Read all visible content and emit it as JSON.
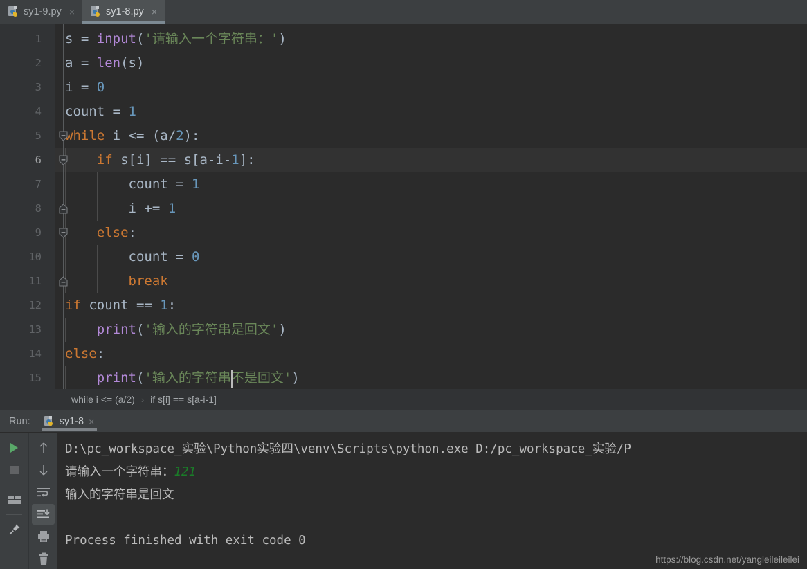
{
  "editor_tabs": [
    {
      "label": "sy1-9.py",
      "icon": "python-file-icon",
      "close": "×",
      "active": false
    },
    {
      "label": "sy1-8.py",
      "icon": "python-file-icon",
      "close": "×",
      "active": true
    }
  ],
  "code": {
    "lines": [
      {
        "n": "1",
        "tokens": [
          {
            "t": "s",
            "c": "var"
          },
          {
            "t": " = ",
            "c": "op"
          },
          {
            "t": "input",
            "c": "fn"
          },
          {
            "t": "(",
            "c": "op"
          },
          {
            "t": "'请输入一个字符串：'",
            "c": "str"
          },
          {
            "t": ")",
            "c": "op"
          }
        ]
      },
      {
        "n": "2",
        "tokens": [
          {
            "t": "a",
            "c": "var"
          },
          {
            "t": " = ",
            "c": "op"
          },
          {
            "t": "len",
            "c": "fn"
          },
          {
            "t": "(s)",
            "c": "op"
          }
        ]
      },
      {
        "n": "3",
        "tokens": [
          {
            "t": "i",
            "c": "var"
          },
          {
            "t": " = ",
            "c": "op"
          },
          {
            "t": "0",
            "c": "num"
          }
        ]
      },
      {
        "n": "4",
        "tokens": [
          {
            "t": "count",
            "c": "var"
          },
          {
            "t": " = ",
            "c": "op"
          },
          {
            "t": "1",
            "c": "num"
          }
        ]
      },
      {
        "n": "5",
        "tokens": [
          {
            "t": "while",
            "c": "kw"
          },
          {
            "t": " i <= (a/",
            "c": "op"
          },
          {
            "t": "2",
            "c": "num"
          },
          {
            "t": "):",
            "c": "op"
          }
        ]
      },
      {
        "n": "6",
        "tokens": [
          {
            "t": "    ",
            "c": "op"
          },
          {
            "t": "if",
            "c": "kw"
          },
          {
            "t": " s[i] == s[a-i-",
            "c": "op"
          },
          {
            "t": "1",
            "c": "num"
          },
          {
            "t": "]:",
            "c": "op"
          }
        ]
      },
      {
        "n": "7",
        "tokens": [
          {
            "t": "        count = ",
            "c": "op"
          },
          {
            "t": "1",
            "c": "num"
          }
        ]
      },
      {
        "n": "8",
        "tokens": [
          {
            "t": "        i += ",
            "c": "op"
          },
          {
            "t": "1",
            "c": "num"
          }
        ]
      },
      {
        "n": "9",
        "tokens": [
          {
            "t": "    ",
            "c": "op"
          },
          {
            "t": "else",
            "c": "kw"
          },
          {
            "t": ":",
            "c": "op"
          }
        ]
      },
      {
        "n": "10",
        "tokens": [
          {
            "t": "        count = ",
            "c": "op"
          },
          {
            "t": "0",
            "c": "num"
          }
        ]
      },
      {
        "n": "11",
        "tokens": [
          {
            "t": "        ",
            "c": "op"
          },
          {
            "t": "break",
            "c": "kw"
          }
        ]
      },
      {
        "n": "12",
        "tokens": [
          {
            "t": "if",
            "c": "kw"
          },
          {
            "t": " count == ",
            "c": "op"
          },
          {
            "t": "1",
            "c": "num"
          },
          {
            "t": ":",
            "c": "op"
          }
        ]
      },
      {
        "n": "13",
        "tokens": [
          {
            "t": "    ",
            "c": "op"
          },
          {
            "t": "print",
            "c": "fn"
          },
          {
            "t": "(",
            "c": "op"
          },
          {
            "t": "'输入的字符串是回文'",
            "c": "str"
          },
          {
            "t": ")",
            "c": "op"
          }
        ]
      },
      {
        "n": "14",
        "tokens": [
          {
            "t": "else",
            "c": "kw"
          },
          {
            "t": ":",
            "c": "op"
          }
        ]
      },
      {
        "n": "15",
        "tokens": [
          {
            "t": "    ",
            "c": "op"
          },
          {
            "t": "print",
            "c": "fn"
          },
          {
            "t": "(",
            "c": "op"
          },
          {
            "t": "'输入的字符串不是回文'",
            "c": "str"
          },
          {
            "t": ")",
            "c": "op"
          }
        ]
      }
    ],
    "current_line": 6,
    "fold_markers": [
      {
        "line": 5,
        "type": "open"
      },
      {
        "line": 6,
        "type": "open"
      },
      {
        "line": 8,
        "type": "end"
      },
      {
        "line": 9,
        "type": "open"
      },
      {
        "line": 11,
        "type": "end"
      }
    ]
  },
  "breadcrumb": {
    "items": [
      "while i <= (a/2)",
      "if s[i] == s[a-i-1]"
    ],
    "separator": "›"
  },
  "run_panel": {
    "label": "Run:",
    "tab_label": "sy1-8",
    "tab_icon": "python-file-icon",
    "tab_close": "×",
    "left_tools": [
      "run-icon",
      "stop-icon",
      "layout-icon",
      "pin-icon"
    ],
    "right_tools": [
      "arrow-up-icon",
      "arrow-down-icon",
      "soft-wrap-icon",
      "scroll-to-end-icon",
      "print-icon",
      "trash-icon"
    ],
    "selected_tool": "scroll-to-end-icon"
  },
  "console": {
    "lines": [
      {
        "text": "D:\\pc_workspace_实验\\Python实验四\\venv\\Scripts\\python.exe D:/pc_workspace_实验/P",
        "kind": "cmd"
      },
      {
        "text": "请输入一个字符串：",
        "input": "121",
        "kind": "prompt"
      },
      {
        "text": "输入的字符串是回文",
        "kind": "out"
      },
      {
        "text": "",
        "kind": "blank"
      },
      {
        "text": "Process finished with exit code 0",
        "kind": "out"
      }
    ],
    "watermark": "https://blog.csdn.net/yangleileileilei"
  },
  "colors": {
    "editor_bg": "#2b2b2b",
    "gutter_bg": "#313335",
    "chrome_bg": "#3c3f41",
    "keyword": "#cc7832",
    "function": "#b389d8",
    "number": "#6897bb",
    "string": "#6a8759",
    "text": "#a9b7c6",
    "input_green": "#1a7d28",
    "run_green": "#59a869"
  }
}
